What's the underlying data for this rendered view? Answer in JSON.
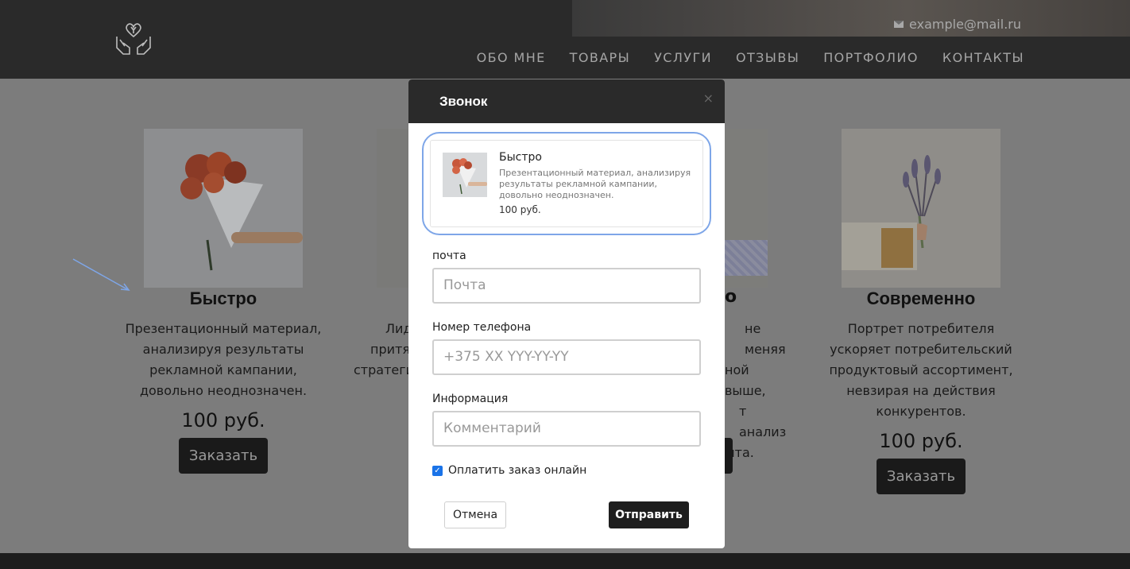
{
  "header": {
    "email": "example@mail.ru",
    "nav": [
      "ОБО МНЕ",
      "ТОВАРЫ",
      "УСЛУГИ",
      "ОТЗЫВЫ",
      "ПОРТФОЛИО",
      "КОНТАКТЫ"
    ]
  },
  "cards": [
    {
      "title": "Быстро",
      "description": "Презентационный материал, анализируя результаты рекламной кампании, довольно неоднозначен.",
      "price": "100 руб.",
      "button": "Заказать"
    },
    {
      "title": "Современно",
      "description": "Портрет потребителя ускоряет потребительский продуктовый ассортимент, невзирая на действия конкурентов.",
      "price": "100 руб.",
      "button": "Заказать"
    }
  ],
  "partial": {
    "card2_lines": [
      "Лид",
      "притя",
      "стратеги"
    ],
    "card3_lines": [
      "не меняя",
      "ной выше,",
      "т анализ",
      "ыта."
    ],
    "card3_title_tail": "о"
  },
  "modal": {
    "title": "Звонок",
    "close": "×",
    "product": {
      "name": "Быстро",
      "description": "Презентационный материал, анализируя результаты рекламной кампании, довольно неоднозначен.",
      "price": "100 руб."
    },
    "fields": [
      {
        "label": "почта",
        "placeholder": "Почта"
      },
      {
        "label": "Номер телефона",
        "placeholder": "+375 XX YYY-YY-YY"
      },
      {
        "label": "Информация",
        "placeholder": "Комментарий"
      }
    ],
    "checkbox_label": "Оплатить заказ онлайн",
    "checkbox_checked": true,
    "cancel": "Отмена",
    "submit": "Отправить"
  },
  "colors": {
    "accent_outline": "#7ea6e8",
    "checkbox": "#1a73e8",
    "dark": "#1e1e1e"
  }
}
